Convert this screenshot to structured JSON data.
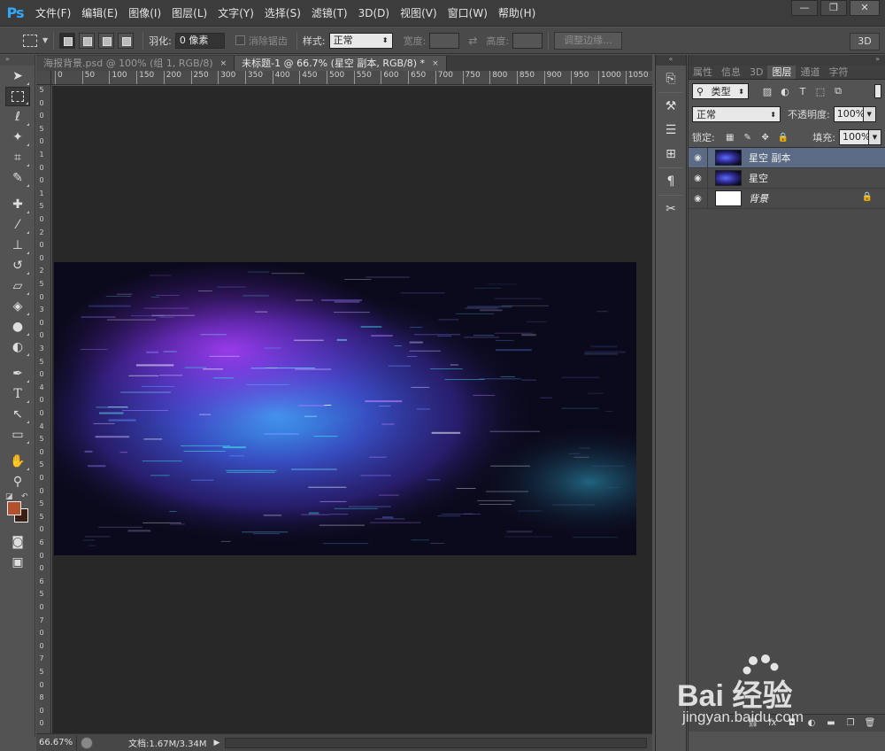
{
  "app": {
    "logo": "Ps"
  },
  "menu": [
    "文件(F)",
    "编辑(E)",
    "图像(I)",
    "图层(L)",
    "文字(Y)",
    "选择(S)",
    "滤镜(T)",
    "3D(D)",
    "视图(V)",
    "窗口(W)",
    "帮助(H)"
  ],
  "window_controls": {
    "minimize": "—",
    "restore": "❐",
    "close": "✕"
  },
  "options": {
    "feather_label": "羽化:",
    "feather_value": "0 像素",
    "antialias_label": "消除锯齿",
    "style_label": "样式:",
    "style_value": "正常",
    "width_label": "宽度:",
    "height_label": "高度:",
    "refine_edge": "调整边缘...",
    "btn_3d": "3D"
  },
  "tabs": [
    {
      "label": "海报背景.psd @ 100% (组 1, RGB/8)",
      "close": "×"
    },
    {
      "label": "未标题-1 @ 66.7% (星空 副本, RGB/8) *",
      "close": "×"
    }
  ],
  "ruler_h": [
    "0",
    "50",
    "100",
    "150",
    "200",
    "250",
    "300",
    "350",
    "400",
    "450",
    "500",
    "550",
    "600",
    "650",
    "700",
    "750",
    "800",
    "850",
    "900",
    "950",
    "1000",
    "1050"
  ],
  "ruler_v": [
    "5",
    "0",
    "0",
    "5",
    "0",
    "1",
    "0",
    "0",
    "1",
    "5",
    "0",
    "2",
    "0",
    "0",
    "2",
    "5",
    "0",
    "3",
    "0",
    "0",
    "3",
    "5",
    "0",
    "4",
    "0",
    "0",
    "4",
    "5",
    "0",
    "5",
    "0",
    "0",
    "5",
    "5",
    "0",
    "6",
    "0",
    "0",
    "6",
    "5",
    "0",
    "7",
    "0",
    "0",
    "7",
    "5",
    "0",
    "8",
    "0",
    "0"
  ],
  "status": {
    "zoom": "66.67%",
    "doc_info": "文档:1.67M/3.34M",
    "arrow": "▶"
  },
  "colors": {
    "foreground": "#b5502f",
    "background": "#3a1f14",
    "accent": "#31a8ff"
  },
  "panel": {
    "tabs": [
      "属性",
      "信息",
      "3D",
      "图层",
      "通道",
      "字符"
    ],
    "active_tab": "图层",
    "filter_type": "类型",
    "blend_mode": "正常",
    "opacity_label": "不透明度:",
    "opacity_value": "100%",
    "lock_label": "锁定:",
    "fill_label": "填充:",
    "fill_value": "100%",
    "layers": [
      {
        "name": "星空 副本",
        "selected": true,
        "thumb": "star"
      },
      {
        "name": "星空",
        "selected": false,
        "thumb": "star"
      },
      {
        "name": "背景",
        "selected": false,
        "thumb": "white",
        "locked": true
      }
    ]
  },
  "watermark": {
    "text": "Bai 经验",
    "sub": "jingyan.baidu.com"
  }
}
